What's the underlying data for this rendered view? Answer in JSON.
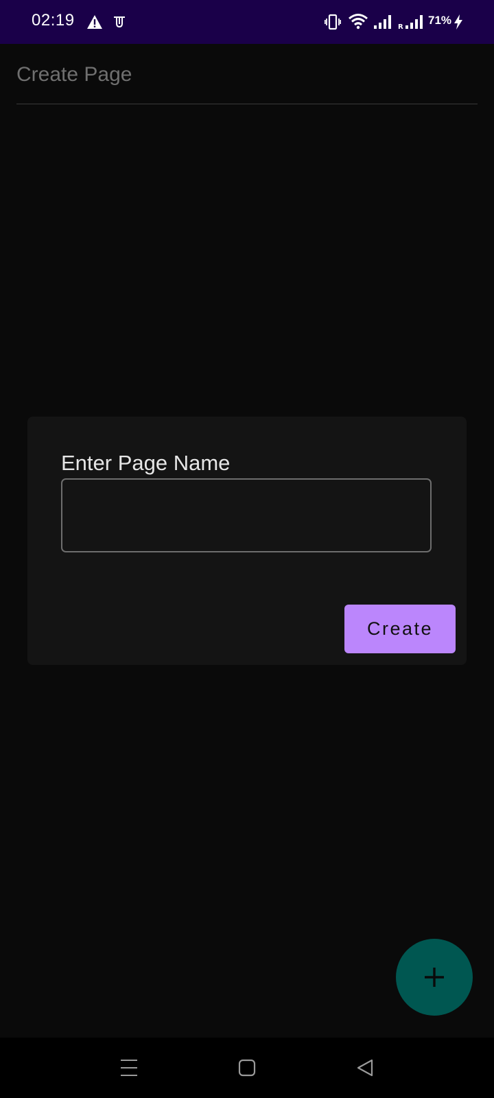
{
  "status_bar": {
    "time": "02:19",
    "battery_percent": "71%",
    "background": "#1a0049",
    "icons": [
      "warning-icon",
      "app-notification-icon",
      "vibrate-icon",
      "wifi-icon",
      "signal-icon",
      "roaming-signal-icon",
      "charging-icon"
    ]
  },
  "header": {
    "title": "Create Page"
  },
  "dialog": {
    "label": "Enter Page Name",
    "input_value": "",
    "input_placeholder": "",
    "create_button": "Create"
  },
  "fab": {
    "icon": "plus-icon",
    "color": "#005751"
  },
  "nav_bar": {
    "buttons": [
      "menu-icon",
      "home-icon",
      "back-icon"
    ]
  },
  "colors": {
    "accent": "#bb86fc",
    "background": "#0a0a0a",
    "card": "#141414"
  }
}
